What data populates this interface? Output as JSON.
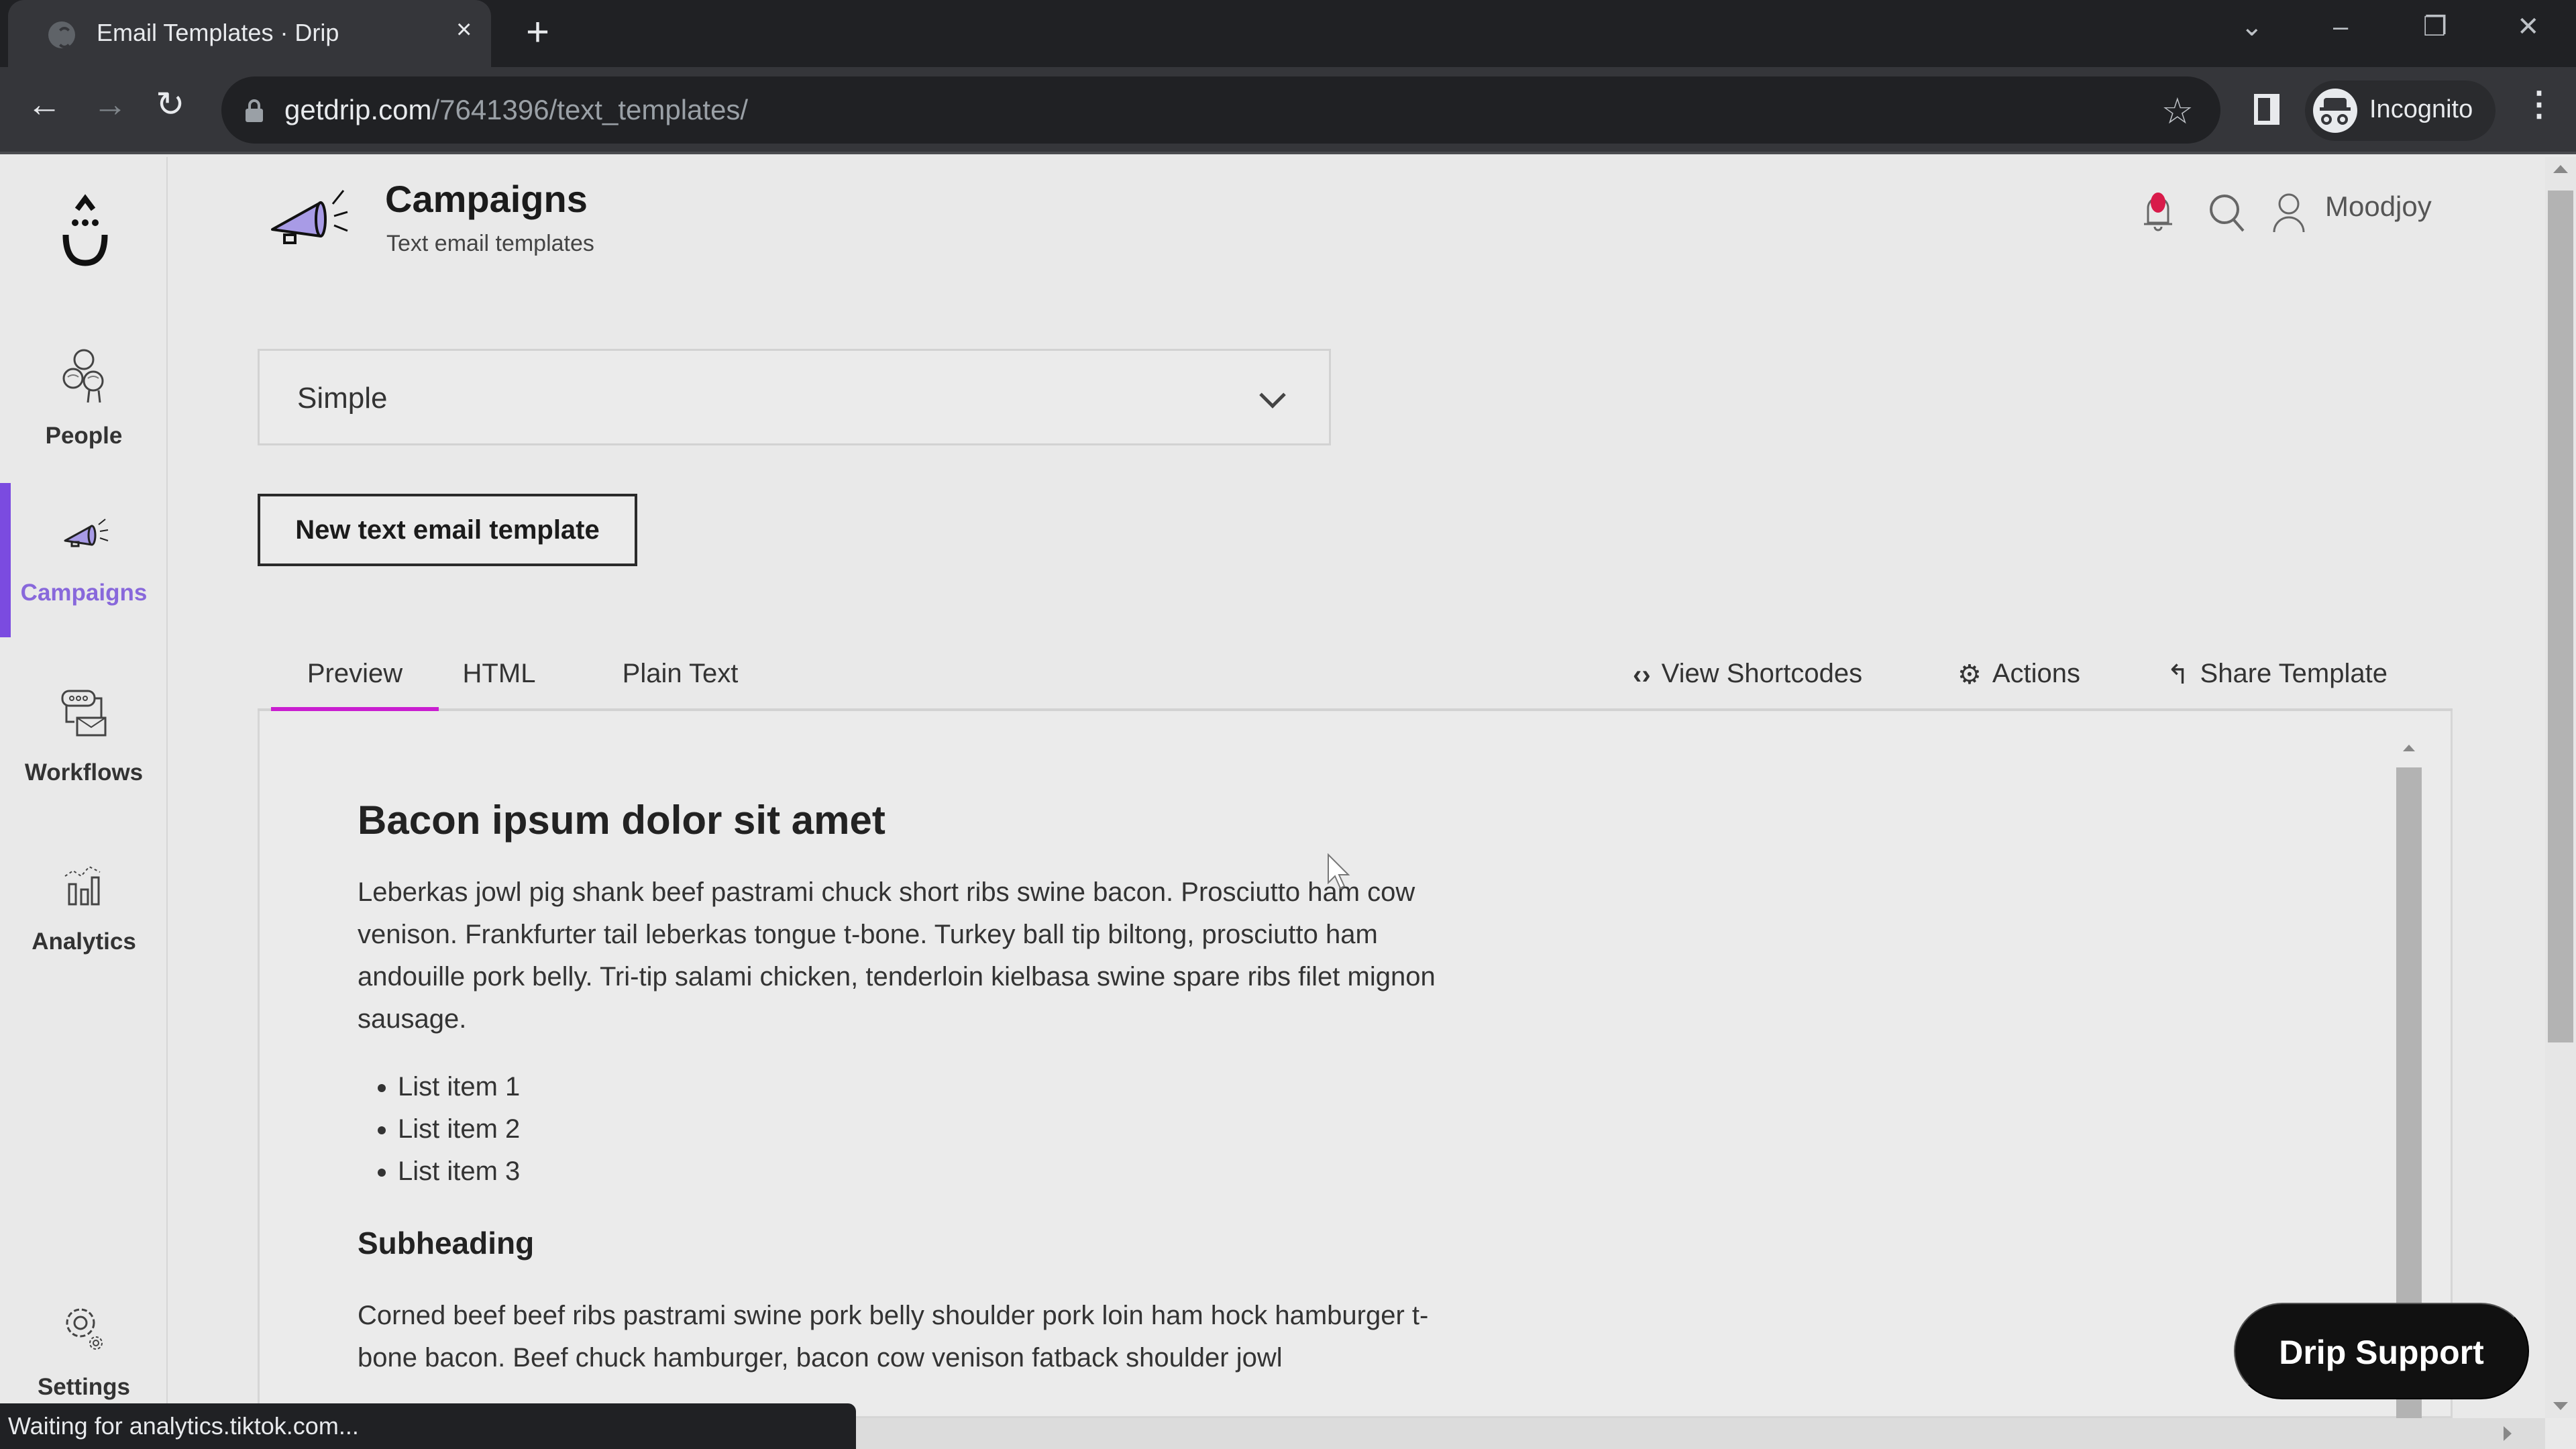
{
  "browser": {
    "tab_title": "Email Templates · Drip",
    "tab_close": "×",
    "new_tab": "+",
    "url_host": "getdrip.com",
    "url_path": "/7641396/text_templates/",
    "profile_label": "Incognito",
    "status_text": "Waiting for analytics.tiktok.com..."
  },
  "sidebar": {
    "items": [
      {
        "label": "People",
        "icon": "people-icon",
        "active": false
      },
      {
        "label": "Campaigns",
        "icon": "megaphone-icon",
        "active": true
      },
      {
        "label": "Workflows",
        "icon": "workflow-icon",
        "active": false
      },
      {
        "label": "Analytics",
        "icon": "analytics-icon",
        "active": false
      },
      {
        "label": "Settings",
        "icon": "gear-icon",
        "active": false
      }
    ]
  },
  "header": {
    "title": "Campaigns",
    "subtitle": "Text email templates",
    "username": "Moodjoy",
    "notification_color": "#d81b4a"
  },
  "template_select": {
    "value": "Simple"
  },
  "new_template_button": "New text email template",
  "tabs": [
    {
      "label": "Preview",
      "active": true
    },
    {
      "label": "HTML",
      "active": false
    },
    {
      "label": "Plain Text",
      "active": false
    }
  ],
  "actions": {
    "view_shortcodes": "View Shortcodes",
    "actions": "Actions",
    "share_template": "Share Template"
  },
  "preview": {
    "heading": "Bacon ipsum dolor sit amet",
    "paragraph1": "Leberkas jowl pig shank beef pastrami chuck short ribs swine bacon. Prosciutto ham cow venison. Frankfurter tail leberkas tongue t-bone. Turkey ball tip biltong, prosciutto ham andouille pork belly. Tri-tip salami chicken, tenderloin kielbasa swine spare ribs filet mignon sausage.",
    "list": [
      "List item 1",
      "List item 2",
      "List item 3"
    ],
    "subheading": "Subheading",
    "paragraph2": "Corned beef beef ribs pastrami swine pork belly shoulder pork loin ham hock hamburger t-bone bacon. Beef chuck hamburger, bacon cow venison fatback shoulder jowl"
  },
  "support_button": "Drip Support",
  "colors": {
    "accent_purple": "#8868db",
    "active_bar": "#7b4be0",
    "tab_underline": "#c91ed0",
    "support_bg": "#111111"
  }
}
